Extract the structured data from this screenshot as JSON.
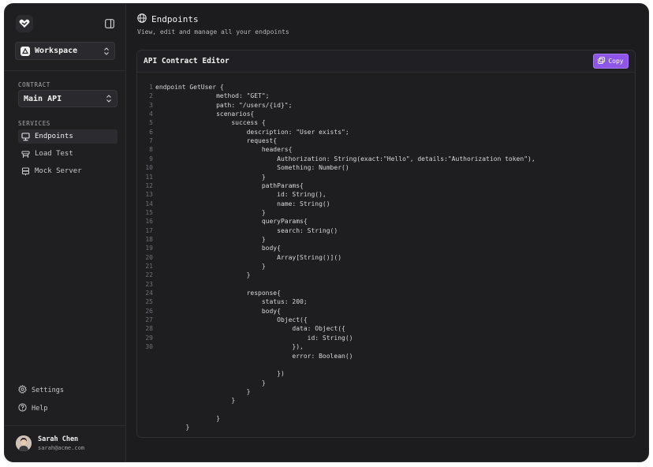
{
  "sidebar": {
    "workspace_label": "Workspace",
    "contract_section": "CONTRACT",
    "contract_value": "Main API",
    "services_section": "SERVICES",
    "nav": [
      {
        "label": "Endpoints",
        "icon": "monitor-icon",
        "active": true
      },
      {
        "label": "Load Test",
        "icon": "load-test-icon",
        "active": false
      },
      {
        "label": "Mock Server",
        "icon": "server-icon",
        "active": false
      }
    ],
    "settings_label": "Settings",
    "help_label": "Help",
    "user": {
      "name": "Sarah Chen",
      "email": "sarah@acme.com"
    }
  },
  "header": {
    "title": "Endpoints",
    "subtitle": "View, edit and manage all your endpoints"
  },
  "editor": {
    "title": "API Contract Editor",
    "copy_label": "Copy",
    "line_numbers": [
      "1",
      "2",
      "3",
      "4",
      "5",
      "6",
      "7",
      "8",
      "9",
      "10",
      "11",
      "12",
      "13",
      "14",
      "15",
      "16",
      "17",
      "18",
      "19",
      "20",
      "21",
      "22",
      "23",
      "24",
      "25",
      "26",
      "27",
      "28",
      "29",
      "30"
    ],
    "lines": [
      "endpoint GetUser {",
      "                method: \"GET\";",
      "                path: \"/users/{id}\";",
      "                scenarios{",
      "                    success {",
      "                        description: \"User exists\";",
      "                        request{",
      "                            headers{",
      "                                Authorization: String(exact:\"Hello\", details:\"Authorization token\"),",
      "                                Something: Number()",
      "                            }",
      "                            pathParams{",
      "                                id: String(),",
      "                                name: String()",
      "                            }",
      "                            queryParams{",
      "                                search: String()",
      "                            }",
      "                            body{",
      "                                Array[String()]()",
      "                            }",
      "                        }",
      "",
      "                        response{",
      "                            status: 200;",
      "                            body{",
      "                                Object({",
      "                                    data: Object({",
      "                                        id: String()",
      "                                    }),",
      "                                    error: Boolean()",
      "",
      "                                })",
      "                            }",
      "                        }",
      "                    }",
      "",
      "                }",
      "        }"
    ]
  },
  "colors": {
    "accent": "#8d55e8",
    "background": "#1c1c1f"
  }
}
